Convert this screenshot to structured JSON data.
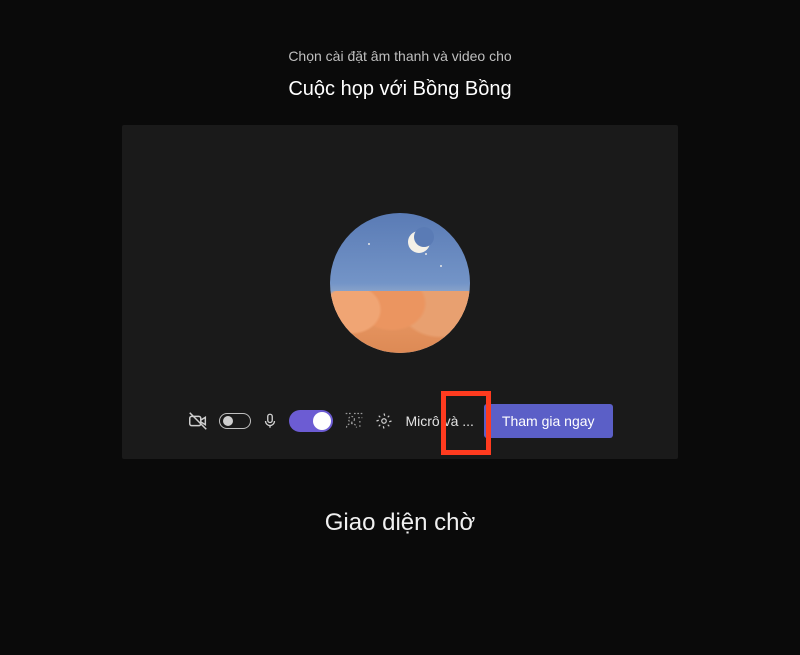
{
  "header": {
    "subtitle": "Chọn cài đặt âm thanh và video cho",
    "title": "Cuộc họp với Bồng Bồng"
  },
  "controls": {
    "camera_icon": "camera-off-icon",
    "camera_toggle_state": "off",
    "mic_icon": "mic-icon",
    "mic_toggle_state": "on",
    "background_icon": "background-blur-icon",
    "settings_icon": "gear-icon",
    "device_label": "Micrô và ...",
    "join_label": "Tham gia ngay"
  },
  "caption": "Giao diện chờ",
  "highlight": {
    "target": "background-filters-button"
  },
  "colors": {
    "accent": "#5b5fc7",
    "toggle_on": "#6c5cd3",
    "highlight_border": "#ff3b1f",
    "bg": "#0a0a0a",
    "panel_bg": "#1a1a1a"
  }
}
